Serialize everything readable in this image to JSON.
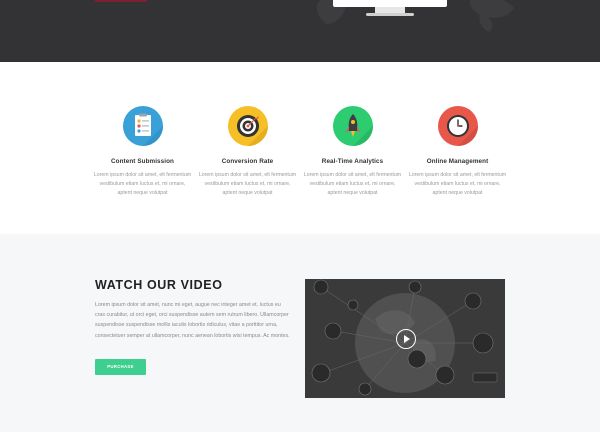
{
  "colors": {
    "hero_bg": "#333335",
    "hero_accent": "#7a2030",
    "section_alt_bg": "#f6f7f9",
    "button_green": "#3ecf8e",
    "video_bg": "#3a3a3a",
    "icon_blue": "#3aa0d8",
    "icon_yellow": "#f6bf26",
    "icon_green": "#2ecc71",
    "icon_red": "#e8584a"
  },
  "features": [
    {
      "icon": "clipboard-icon",
      "title": "Content Submission",
      "text": [
        "Lorem ipsum dolor sit amet, elt fermentum",
        "vestibulum etiam luctus et, mi ornare,",
        "aptent neque volutpat"
      ]
    },
    {
      "icon": "target-icon",
      "title": "Conversion Rate",
      "text": [
        "Lorem ipsum dolor sit amet, elt fermentum",
        "vestibulum etiam luctus et, mi ornare,",
        "aptent neque volutpat"
      ]
    },
    {
      "icon": "rocket-icon",
      "title": "Real-Time Analytics",
      "text": [
        "Lorem ipsum dolor sit amet, elt fermentum",
        "vestibulum etiam luctus et, mi ornare,",
        "aptent neque volutpat"
      ]
    },
    {
      "icon": "clock-icon",
      "title": "Online Management",
      "text": [
        "Lorem ipsum dolor sit amet, elt fermentum",
        "vestibulum etiam luctus et, mi ornare,",
        "aptent neque volutpat"
      ]
    }
  ],
  "video": {
    "title": "WATCH OUR VIDEO",
    "text": "Lorem ipsum dolor sit amet, nunc mi eget, augue nec integer amet et, luctus eu cras curabitur, ut orci eget, orci suspendisse autem sem rutrum libero. Ullamcorper suspendisse suspendisse mollis iaculis lobortis ridiculus, vitae a porttitor urna, consectetuer semper at ullamcorper, nunc aenean lobortis wisi tempus. Ac montes.",
    "button_label": "PURCHASE",
    "play_icon": "play-icon"
  }
}
